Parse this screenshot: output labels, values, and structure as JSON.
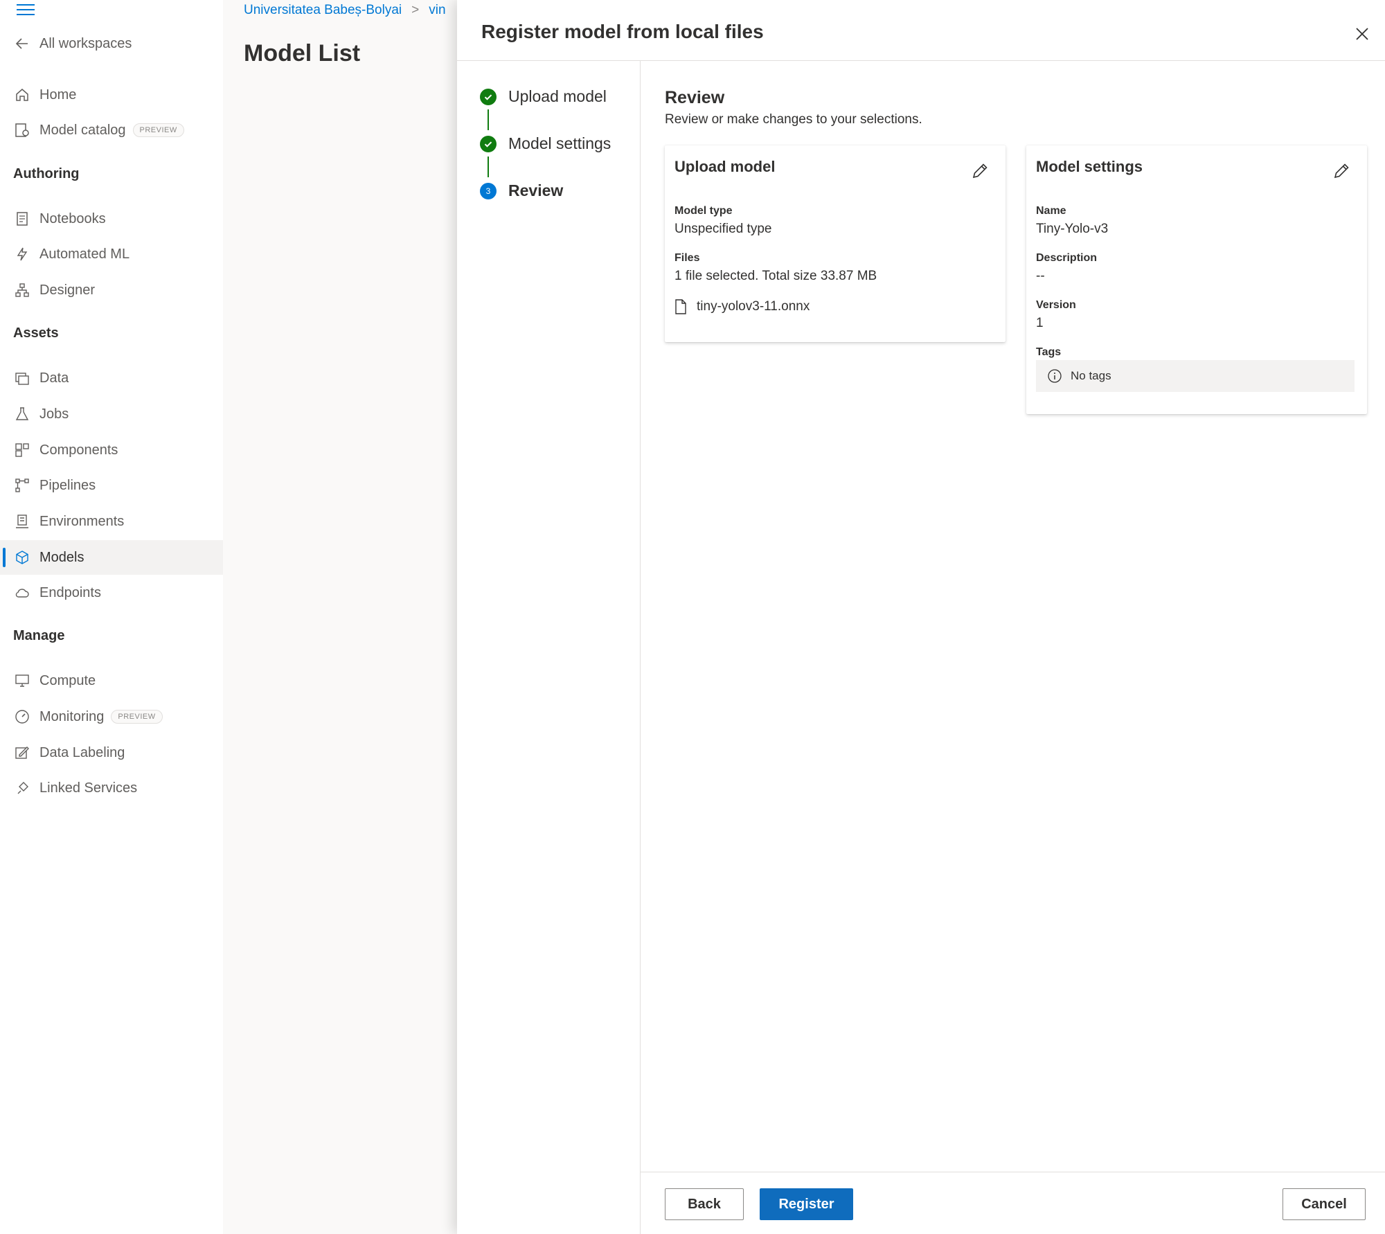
{
  "nav": {
    "back_label": "All workspaces",
    "items_top": [
      {
        "label": "Home",
        "icon": "home-icon"
      },
      {
        "label": "Model catalog",
        "icon": "model-catalog-icon",
        "badge": "PREVIEW"
      }
    ],
    "sections": [
      {
        "heading": "Authoring",
        "items": [
          {
            "label": "Notebooks",
            "icon": "notebook-icon"
          },
          {
            "label": "Automated ML",
            "icon": "automated-ml-icon"
          },
          {
            "label": "Designer",
            "icon": "designer-icon"
          }
        ]
      },
      {
        "heading": "Assets",
        "items": [
          {
            "label": "Data",
            "icon": "data-icon"
          },
          {
            "label": "Jobs",
            "icon": "flask-icon"
          },
          {
            "label": "Components",
            "icon": "components-icon"
          },
          {
            "label": "Pipelines",
            "icon": "pipelines-icon"
          },
          {
            "label": "Environments",
            "icon": "environment-icon"
          },
          {
            "label": "Models",
            "icon": "cube-icon",
            "active": true
          },
          {
            "label": "Endpoints",
            "icon": "endpoint-cloud-icon"
          }
        ]
      },
      {
        "heading": "Manage",
        "items": [
          {
            "label": "Compute",
            "icon": "monitor-icon"
          },
          {
            "label": "Monitoring",
            "icon": "gauge-icon",
            "badge": "PREVIEW"
          },
          {
            "label": "Data Labeling",
            "icon": "labeling-icon"
          },
          {
            "label": "Linked Services",
            "icon": "link-icon"
          }
        ]
      }
    ]
  },
  "background": {
    "breadcrumb": [
      "Universitatea Babeș-Bolyai",
      "vin"
    ],
    "page_title": "Model List"
  },
  "panel": {
    "title": "Register model from local files",
    "steps": [
      {
        "label": "Upload model",
        "state": "done"
      },
      {
        "label": "Model settings",
        "state": "done"
      },
      {
        "label": "Review",
        "state": "current",
        "number": "3"
      }
    ],
    "review": {
      "title": "Review",
      "subtitle": "Review or make changes to your selections.",
      "upload_card": {
        "title": "Upload model",
        "model_type_label": "Model type",
        "model_type_value": "Unspecified type",
        "files_label": "Files",
        "files_value": "1 file selected. Total size 33.87 MB",
        "file_name": "tiny-yolov3-11.onnx"
      },
      "settings_card": {
        "title": "Model settings",
        "name_label": "Name",
        "name_value": "Tiny-Yolo-v3",
        "description_label": "Description",
        "description_value": "--",
        "version_label": "Version",
        "version_value": "1",
        "tags_label": "Tags",
        "tags_value": "No tags"
      }
    },
    "footer": {
      "back": "Back",
      "register": "Register",
      "cancel": "Cancel"
    }
  },
  "colors": {
    "accent": "#0078d4",
    "success": "#107c10",
    "primary_button": "#0f6cbd"
  }
}
